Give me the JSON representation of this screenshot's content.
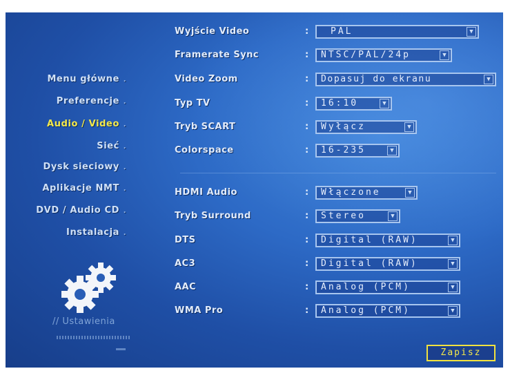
{
  "menu": {
    "items": [
      {
        "label": "Menu główne"
      },
      {
        "label": "Preferencje"
      },
      {
        "label": "Audio / Video"
      },
      {
        "label": "Sieć"
      },
      {
        "label": "Dysk sieciowy"
      },
      {
        "label": "Aplikacje NMT"
      },
      {
        "label": "DVD / Audio CD"
      },
      {
        "label": "Instalacja"
      }
    ],
    "active": "Audio / Video",
    "bullet": "."
  },
  "section_label": "// Ustawienia",
  "settings": {
    "colon": ":",
    "rows": [
      {
        "label": "Wyjście Video",
        "value": "PAL"
      },
      {
        "label": "Framerate Sync",
        "value": "NTSC/PAL/24p"
      },
      {
        "label": "Video Zoom",
        "value": "Dopasuj do ekranu"
      },
      {
        "label": "Typ TV",
        "value": "16:10"
      },
      {
        "label": "Tryb SCART",
        "value": "Wyłącz"
      },
      {
        "label": "Colorspace",
        "value": "16-235"
      },
      {
        "label": "HDMI Audio",
        "value": "Włączone"
      },
      {
        "label": "Tryb Surround",
        "value": "Stereo"
      },
      {
        "label": "DTS",
        "value": "Digital (RAW)"
      },
      {
        "label": "AC3",
        "value": "Digital (RAW)"
      },
      {
        "label": "AAC",
        "value": "Analog (PCM)"
      },
      {
        "label": "WMA Pro",
        "value": "Analog (PCM)"
      }
    ],
    "dropdown_glyph": "▼"
  },
  "save_label": "Zapisz",
  "colors": {
    "accent": "#f5e94a",
    "background": "#2d6ac6",
    "text": "#e2ecfb"
  },
  "icons": [
    "gears-icon",
    "dropdown-arrow-icon"
  ]
}
